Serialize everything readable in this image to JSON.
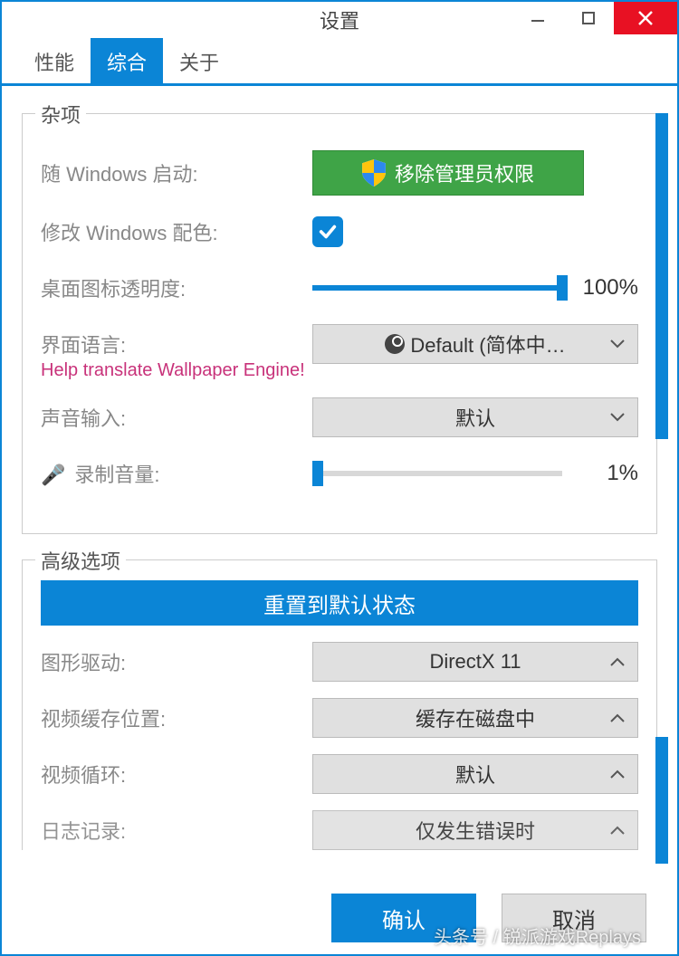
{
  "window": {
    "title": "设置"
  },
  "tabs": {
    "performance": "性能",
    "general": "综合",
    "about": "关于"
  },
  "misc": {
    "legend": "杂项",
    "startup_label": "随 Windows 启动:",
    "remove_admin_btn": "移除管理员权限",
    "theme_label": "修改 Windows 配色:",
    "theme_checked": true,
    "icon_opacity_label": "桌面图标透明度:",
    "icon_opacity_value": "100%",
    "icon_opacity_pct": 100,
    "language_label": "界面语言:",
    "language_value": "Default (简体中…",
    "help_translate": "Help translate Wallpaper Engine!",
    "audio_input_label": "声音输入:",
    "audio_input_value": "默认",
    "record_volume_label": "录制音量:",
    "record_volume_value": "1%",
    "record_volume_pct": 1
  },
  "advanced": {
    "legend": "高级选项",
    "reset_btn": "重置到默认状态",
    "gfx_label": "图形驱动:",
    "gfx_value": "DirectX 11",
    "cache_label": "视频缓存位置:",
    "cache_value": "缓存在磁盘中",
    "loop_label": "视频循环:",
    "loop_value": "默认",
    "log_label": "日志记录:",
    "log_value": "仅发生错误时"
  },
  "footer": {
    "ok": "确认",
    "cancel": "取消"
  },
  "watermark": "头条号 / 锐派游戏Replays"
}
